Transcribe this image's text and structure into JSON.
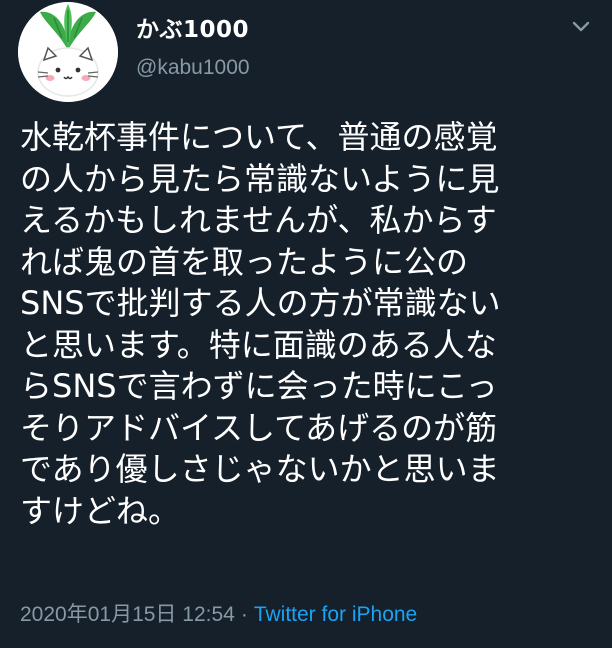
{
  "user": {
    "display_name": "かぶ1000",
    "handle": "@kabu1000"
  },
  "tweet": {
    "text": "水乾杯事件について、普通の感覚\nの人から見たら常識ないように見\nえるかもしれませんが、私からす\nれば鬼の首を取ったように公の\nSNSで批判する人の方が常識ない\nと思います。特に面識のある人な\nらSNSで言わずに会った時にこっ\nそりアドバイスしてあげるのが筋\nであり優しさじゃないかと思いま\nすけどね。",
    "timestamp": "2020年01月15日 12:54",
    "separator": "·",
    "source": "Twitter for iPhone"
  },
  "icons": {
    "avatar": "turnip-cat-avatar",
    "menu": "chevron-down-icon"
  },
  "colors": {
    "background": "#15202b",
    "primary_text": "#ffffff",
    "secondary_text": "#8899a6",
    "link": "#1da1f2"
  }
}
